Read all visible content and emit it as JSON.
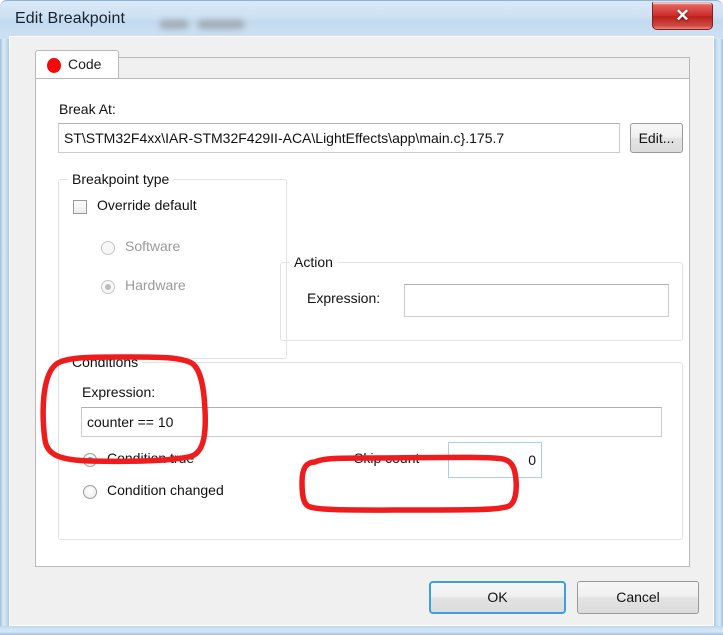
{
  "window": {
    "title": "Edit Breakpoint",
    "close_label": "✕",
    "close_icon": "close-icon"
  },
  "tabs": [
    {
      "label": "Code",
      "icon": "breakpoint-dot-icon",
      "selected": true
    }
  ],
  "break_at": {
    "label": "Break At:",
    "value": "ST\\STM32F4xx\\IAR-STM32F429II-ACA\\LightEffects\\app\\main.c}.175.7",
    "edit_button": "Edit..."
  },
  "breakpoint_type": {
    "title": "Breakpoint type",
    "override_default": {
      "label": "Override default",
      "checked": false
    },
    "options": [
      {
        "label": "Software",
        "selected": false,
        "disabled": true
      },
      {
        "label": "Hardware",
        "selected": true,
        "disabled": true
      }
    ]
  },
  "action": {
    "title": "Action",
    "expression_label": "Expression:",
    "expression_value": ""
  },
  "conditions": {
    "title": "Conditions",
    "expression_label": "Expression:",
    "expression_value": "counter == 10",
    "options": [
      {
        "label": "Condition true",
        "selected": true
      },
      {
        "label": "Condition changed",
        "selected": false
      }
    ],
    "skip_count_label": "Skip count",
    "skip_count_value": "0"
  },
  "footer": {
    "ok_label": "OK",
    "cancel_label": "Cancel"
  },
  "colors": {
    "annotation": "#ee1c1c",
    "breakpoint": "#f50808",
    "accent": "#3c9fde",
    "close": "#cd2e2b"
  }
}
